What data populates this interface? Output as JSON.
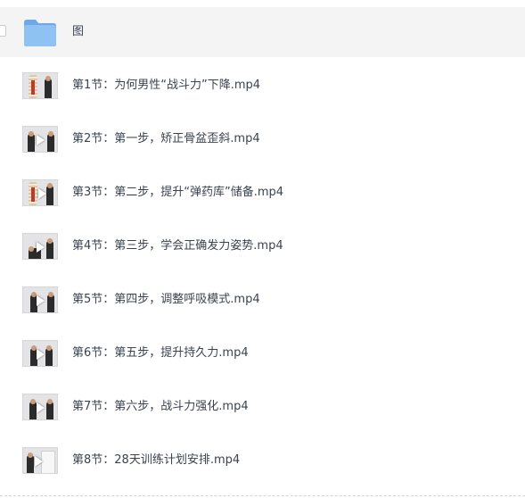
{
  "folder": {
    "name": "图",
    "icon": "folder-icon",
    "color": "#7fb5ec"
  },
  "files": [
    {
      "name": "第1节：为何男性“战斗力”下降.mp4",
      "thumbnail": "video-thumbnail"
    },
    {
      "name": "第2节：第一步，矫正骨盆歪斜.mp4",
      "thumbnail": "video-thumbnail"
    },
    {
      "name": "第3节：第二步，提升“弹药库”储备.mp4",
      "thumbnail": "video-thumbnail"
    },
    {
      "name": "第4节：第三步，学会正确发力姿势.mp4",
      "thumbnail": "video-thumbnail"
    },
    {
      "name": "第5节：第四步，调整呼吸模式.mp4",
      "thumbnail": "video-thumbnail"
    },
    {
      "name": "第6节：第五步，提升持久力.mp4",
      "thumbnail": "video-thumbnail"
    },
    {
      "name": "第7节：第六步，战斗力强化.mp4",
      "thumbnail": "video-thumbnail"
    },
    {
      "name": "第8节：28天训练计划安排.mp4",
      "thumbnail": "video-thumbnail"
    }
  ],
  "colors": {
    "text": "#3b4350",
    "folder_row_bg": "#f4f4f5"
  }
}
